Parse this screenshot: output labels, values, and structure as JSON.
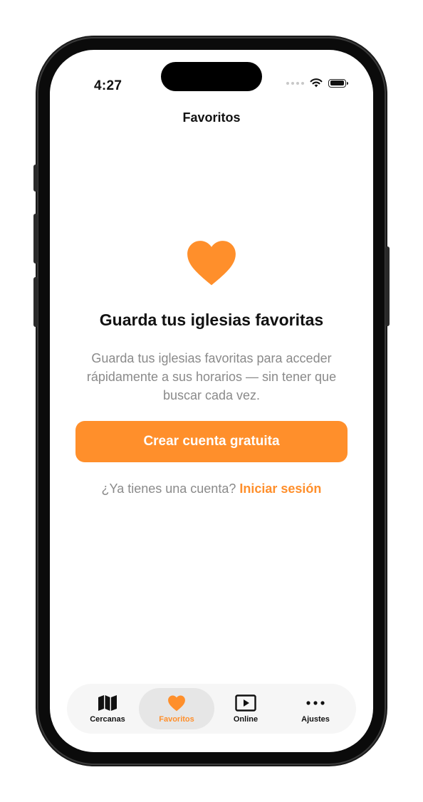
{
  "status_bar": {
    "time": "4:27"
  },
  "nav": {
    "title": "Favoritos"
  },
  "empty_state": {
    "headline": "Guarda tus iglesias favoritas",
    "description": "Guarda tus iglesias favoritas para acceder rápidamente a sus horarios — sin tener que buscar cada vez.",
    "cta_label": "Crear cuenta gratuita",
    "login_prompt": "¿Ya tienes una cuenta?",
    "login_link": "Iniciar sesión"
  },
  "tabbar": {
    "items": [
      {
        "label": "Cercanas",
        "icon": "map-icon",
        "active": false
      },
      {
        "label": "Favoritos",
        "icon": "heart-icon",
        "active": true
      },
      {
        "label": "Online",
        "icon": "play-icon",
        "active": false
      },
      {
        "label": "Ajustes",
        "icon": "more-icon",
        "active": false
      }
    ]
  },
  "colors": {
    "accent": "#ff8f2b",
    "text": "#111111",
    "muted": "#8a8a8a"
  }
}
